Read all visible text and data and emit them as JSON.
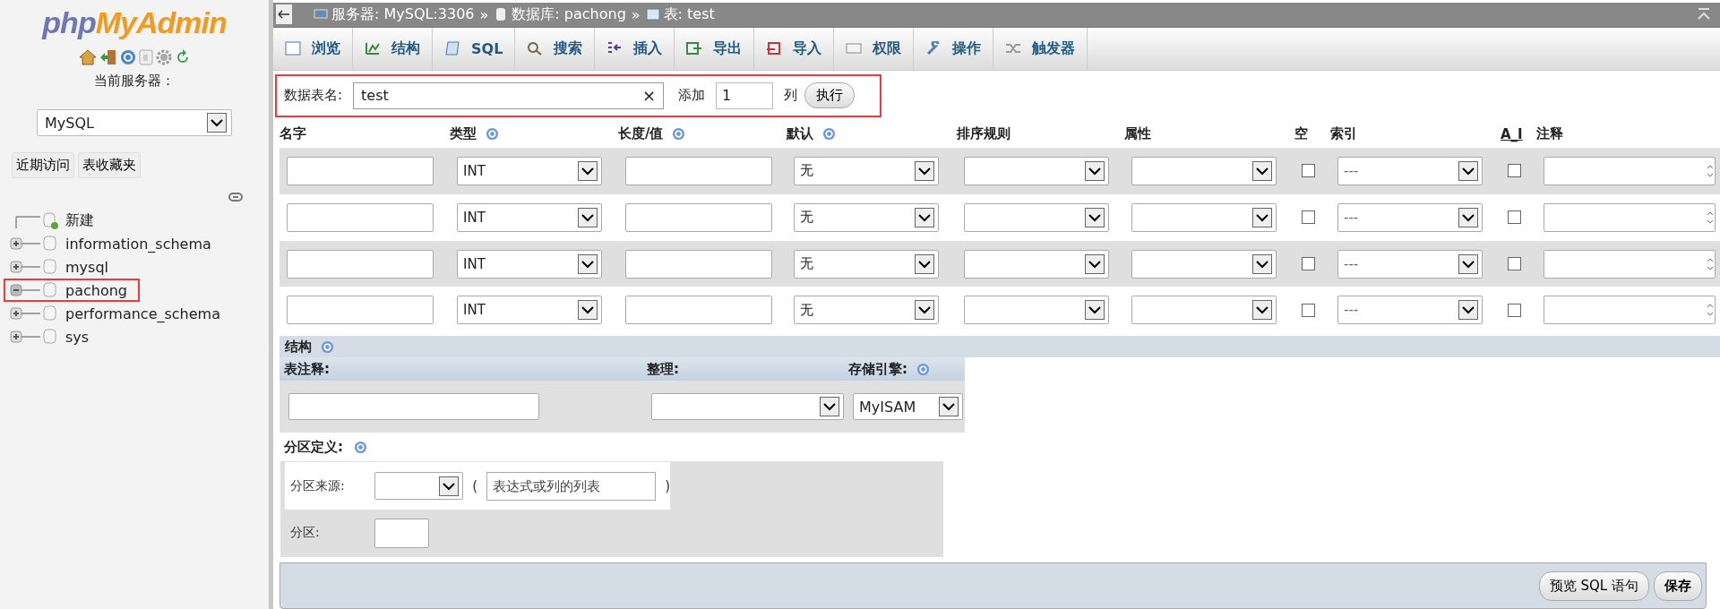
{
  "sidebar": {
    "logo": {
      "part1": "php",
      "part2": "MyAdmin"
    },
    "server_label": "当前服务器：",
    "server_select": "MySQL",
    "buttons": [
      "近期访问",
      "表收藏夹"
    ],
    "tree": [
      {
        "kind": "new",
        "label": "新建",
        "highlighted": false
      },
      {
        "kind": "db",
        "label": "information_schema",
        "expanded": false,
        "highlighted": false
      },
      {
        "kind": "db",
        "label": "mysql",
        "expanded": false,
        "highlighted": false
      },
      {
        "kind": "db",
        "label": "pachong",
        "expanded": true,
        "highlighted": true
      },
      {
        "kind": "db",
        "label": "performance_schema",
        "expanded": false,
        "highlighted": false
      },
      {
        "kind": "db",
        "label": "sys",
        "expanded": false,
        "highlighted": false
      }
    ]
  },
  "breadcrumb": [
    {
      "kind": "server",
      "label": "服务器: MySQL:3306",
      "sep": "»"
    },
    {
      "kind": "database",
      "label": "数据库: pachong",
      "sep": "»"
    },
    {
      "kind": "table",
      "label": "表: test"
    }
  ],
  "tabs": [
    {
      "kind": "browse",
      "label": "浏览"
    },
    {
      "kind": "structure",
      "label": "结构"
    },
    {
      "kind": "sql",
      "label": "SQL"
    },
    {
      "kind": "search",
      "label": "搜索"
    },
    {
      "kind": "insert",
      "label": "插入"
    },
    {
      "kind": "export",
      "label": "导出"
    },
    {
      "kind": "import",
      "label": "导入"
    },
    {
      "kind": "privileges",
      "label": "权限"
    },
    {
      "kind": "operations",
      "label": "操作"
    },
    {
      "kind": "triggers",
      "label": "触发器"
    }
  ],
  "form": {
    "highlighted": true,
    "table_name_label": "数据表名:",
    "table_name": "test",
    "clear": "×",
    "add_label": "添加",
    "add_count": "1",
    "column_label": "列",
    "go": "执行"
  },
  "columns": [
    {
      "label": "名字",
      "help": false,
      "underline": false
    },
    {
      "label": "类型",
      "help": true,
      "underline": false
    },
    {
      "label": "长度/值",
      "help": true,
      "underline": false
    },
    {
      "label": "默认",
      "help": true,
      "underline": false
    },
    {
      "label": "排序规则",
      "help": false,
      "underline": false
    },
    {
      "label": "属性",
      "help": false,
      "underline": false
    },
    {
      "label": "空",
      "help": false,
      "underline": false
    },
    {
      "label": "索引",
      "help": false,
      "underline": false
    },
    {
      "label": "A_I",
      "help": false,
      "underline": true
    },
    {
      "label": "注释",
      "help": false,
      "underline": false
    }
  ],
  "rows": [
    {
      "type": "INT",
      "default": "无",
      "null": false,
      "index": "---",
      "ai": false
    },
    {
      "type": "INT",
      "default": "无",
      "null": false,
      "index": "---",
      "ai": false
    },
    {
      "type": "INT",
      "default": "无",
      "null": false,
      "index": "---",
      "ai": false
    },
    {
      "type": "INT",
      "default": "无",
      "null": false,
      "index": "---",
      "ai": false
    }
  ],
  "structure": {
    "title": "结构",
    "help": true,
    "headers": [
      {
        "label": "表注释:",
        "help": false
      },
      {
        "label": "整理:",
        "help": false
      },
      {
        "label": "存储引擎:",
        "help": true
      }
    ],
    "engine": "MyISAM"
  },
  "partition": {
    "title": "分区定义:",
    "help": true,
    "source_label": "分区来源:",
    "open_paren": "(",
    "placeholder": "表达式或列的列表",
    "close_paren": ")",
    "count_label": "分区:"
  },
  "footer_buttons": [
    {
      "kind": "normal",
      "label": "预览 SQL 语句"
    },
    {
      "kind": "primary",
      "label": "保存"
    }
  ]
}
